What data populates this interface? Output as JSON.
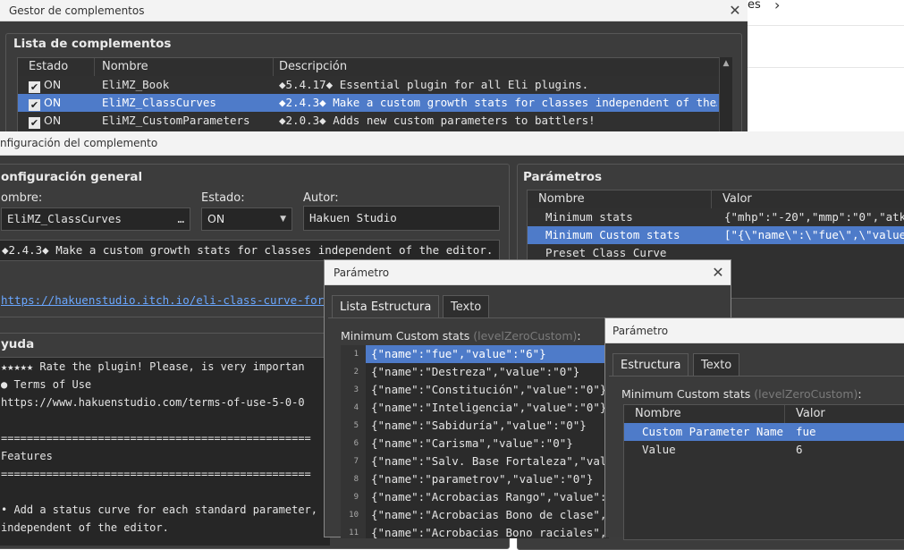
{
  "bg_window": {
    "breadcrumb_tail": "es",
    "chevron": "›"
  },
  "manager": {
    "title": "Gestor de complementos",
    "list_title": "Lista de complementos",
    "columns": [
      "Estado",
      "Nombre",
      "Descripción"
    ],
    "rows": [
      {
        "state": "ON",
        "name": "EliMZ_Book",
        "desc": "◆5.4.17◆ Essential plugin for all Eli plugins.",
        "selected": false
      },
      {
        "state": "ON",
        "name": "EliMZ_ClassCurves",
        "desc": "◆2.4.3◆ Make a custom growth stats for classes independent of the…",
        "selected": true
      },
      {
        "state": "ON",
        "name": "EliMZ_CustomParameters",
        "desc": "◆2.0.3◆ Adds new custom parameters to battlers!",
        "selected": false
      }
    ]
  },
  "config": {
    "title": "nfiguración del complemento",
    "general_title": "onfiguración general",
    "name_label": "ombre:",
    "name_value": "EliMZ_ClassCurves",
    "name_button": "…",
    "state_label": "Estado:",
    "state_value": "ON",
    "author_label": "Autor:",
    "author_value": "Hakuen Studio",
    "description": "◆2.4.3◆ Make a custom growth stats for classes independent of the editor.",
    "link": "https://hakuenstudio.itch.io/eli-class-curve-for-rpg-m",
    "help_title": "yuda",
    "help_lines": [
      "★★★★★ Rate the plugin! Please, is very importan",
      "● Terms of Use",
      "https://www.hakuenstudio.com/terms-of-use-5-0-0",
      "",
      "================================================",
      "Features",
      "================================================",
      "",
      "• Add a status curve for each standard parameter, fu",
      "independent of the editor."
    ],
    "params_title": "Parámetros",
    "params_columns": [
      "Nombre",
      "Valor"
    ],
    "params_rows": [
      {
        "name": "Minimum stats",
        "value": "{\"mhp\":\"-20\",\"mmp\":\"0\",\"atk\":",
        "selected": false
      },
      {
        "name": "Minimum Custom stats",
        "value": "[\"{\\\"name\\\":\\\"fue\\\",\\\"value\\\"",
        "selected": true
      },
      {
        "name": "Preset Class Curve",
        "value": "",
        "selected": false
      }
    ]
  },
  "param_dialog1": {
    "title": "Parámetro",
    "tabs": [
      "Lista Estructura",
      "Texto"
    ],
    "label": "Minimum Custom stats",
    "sublabel": "(levelZeroCustom)",
    "colon": ":",
    "rows": [
      {
        "num": "1",
        "text": "{\"name\":\"fue\",\"value\":\"6\"}",
        "selected": true
      },
      {
        "num": "2",
        "text": "{\"name\":\"Destreza\",\"value\":\"0\"}",
        "selected": false
      },
      {
        "num": "3",
        "text": "{\"name\":\"Constitución\",\"value\":\"0\"}",
        "selected": false
      },
      {
        "num": "4",
        "text": "{\"name\":\"Inteligencia\",\"value\":\"0\"}",
        "selected": false
      },
      {
        "num": "5",
        "text": "{\"name\":\"Sabiduría\",\"value\":\"0\"}",
        "selected": false
      },
      {
        "num": "6",
        "text": "{\"name\":\"Carisma\",\"value\":\"0\"}",
        "selected": false
      },
      {
        "num": "7",
        "text": "{\"name\":\"Salv. Base Fortaleza\",\"value\"",
        "selected": false
      },
      {
        "num": "8",
        "text": "{\"name\":\"parametrov\",\"value\":\"0\"}",
        "selected": false
      },
      {
        "num": "9",
        "text": "{\"name\":\"Acrobacias Rango\",\"value\":\"0\"",
        "selected": false
      },
      {
        "num": "10",
        "text": "{\"name\":\"Acrobacias Bono de clase\",\"va",
        "selected": false
      },
      {
        "num": "11",
        "text": "{\"name\":\"Acrobacias Bono raciales\",\"va",
        "selected": false
      }
    ]
  },
  "param_dialog2": {
    "title": "Parámetro",
    "tabs": [
      "Estructura",
      "Texto"
    ],
    "label": "Minimum Custom stats",
    "sublabel": "(levelZeroCustom)",
    "colon": ":",
    "columns": [
      "Nombre",
      "Valor"
    ],
    "rows": [
      {
        "name": "Custom Parameter Name",
        "value": "fue",
        "selected": true
      },
      {
        "name": "Value",
        "value": "6",
        "selected": false
      }
    ]
  },
  "icons": {
    "close": "✕",
    "check": "✔",
    "dropdown": "▼",
    "scroll_up": "▲"
  },
  "colors": {
    "panel_bg": "#3b3b3b",
    "selection": "#4e7bc9",
    "link": "#6aa7ff"
  }
}
